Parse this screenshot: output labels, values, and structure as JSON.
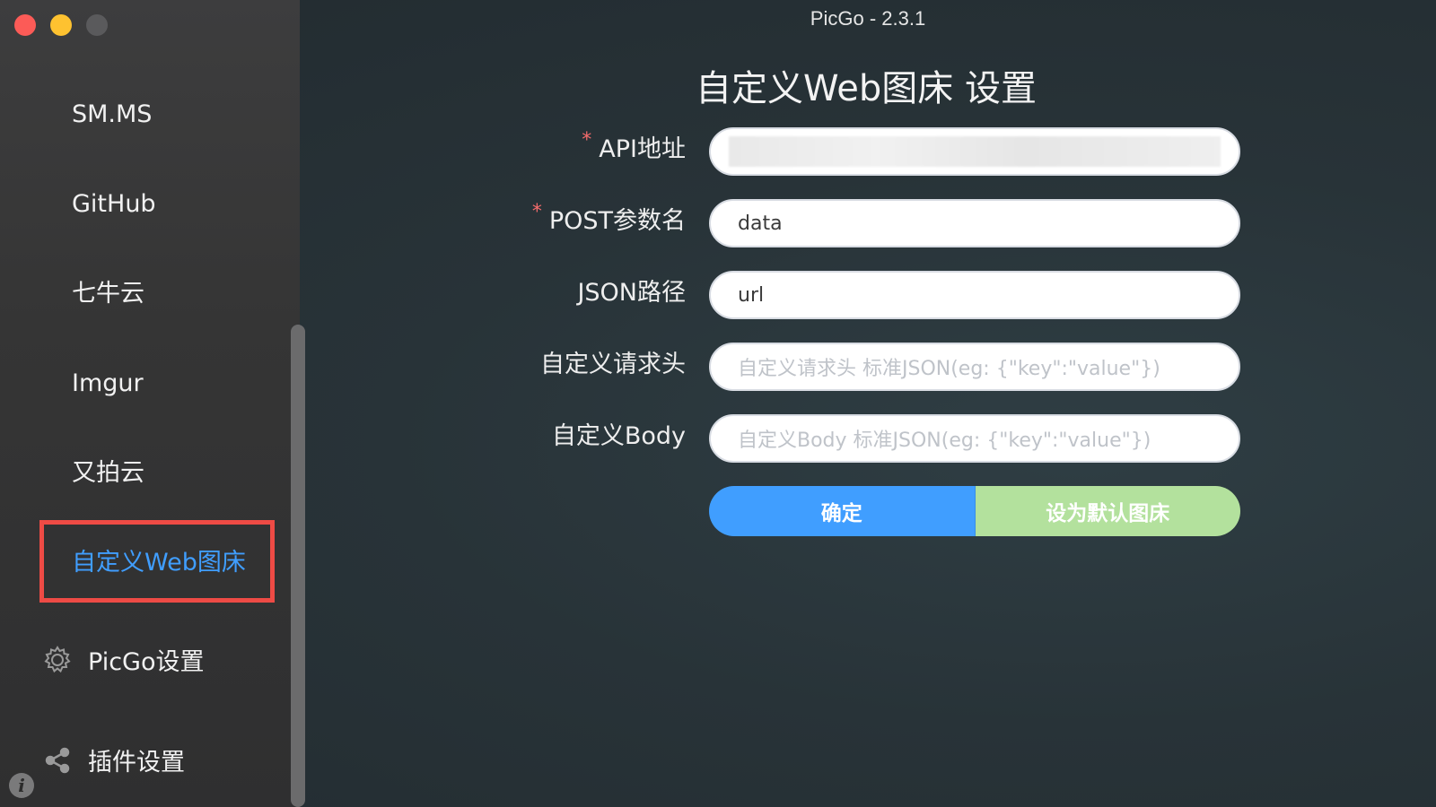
{
  "app": {
    "title": "PicGo - 2.3.1"
  },
  "sidebar": {
    "items": [
      {
        "label": "SM.MS"
      },
      {
        "label": "GitHub"
      },
      {
        "label": "七牛云"
      },
      {
        "label": "Imgur"
      },
      {
        "label": "又拍云"
      },
      {
        "label": "自定义Web图床",
        "active": true
      }
    ],
    "settings_label": "PicGo设置",
    "plugins_label": "插件设置",
    "settings_icon": "gear-icon",
    "plugins_icon": "share-icon",
    "info_icon_glyph": "i"
  },
  "main": {
    "page_title": "自定义Web图床 设置",
    "required_mark": "*",
    "form": {
      "api": {
        "label": "API地址",
        "value": ""
      },
      "post_param": {
        "label": "POST参数名",
        "value": "data"
      },
      "json_path": {
        "label": "JSON路径",
        "value": "url"
      },
      "headers": {
        "label": "自定义请求头",
        "placeholder": "自定义请求头 标准JSON(eg: {\"key\":\"value\"})"
      },
      "body": {
        "label": "自定义Body",
        "placeholder": "自定义Body 标准JSON(eg: {\"key\":\"value\"})"
      }
    },
    "buttons": {
      "confirm": "确定",
      "set_default": "设为默认图床"
    }
  },
  "colors": {
    "accent": "#409eff",
    "success_light": "#b3e19d",
    "required": "#f56c6c",
    "highlight_box": "#ee4b45"
  }
}
